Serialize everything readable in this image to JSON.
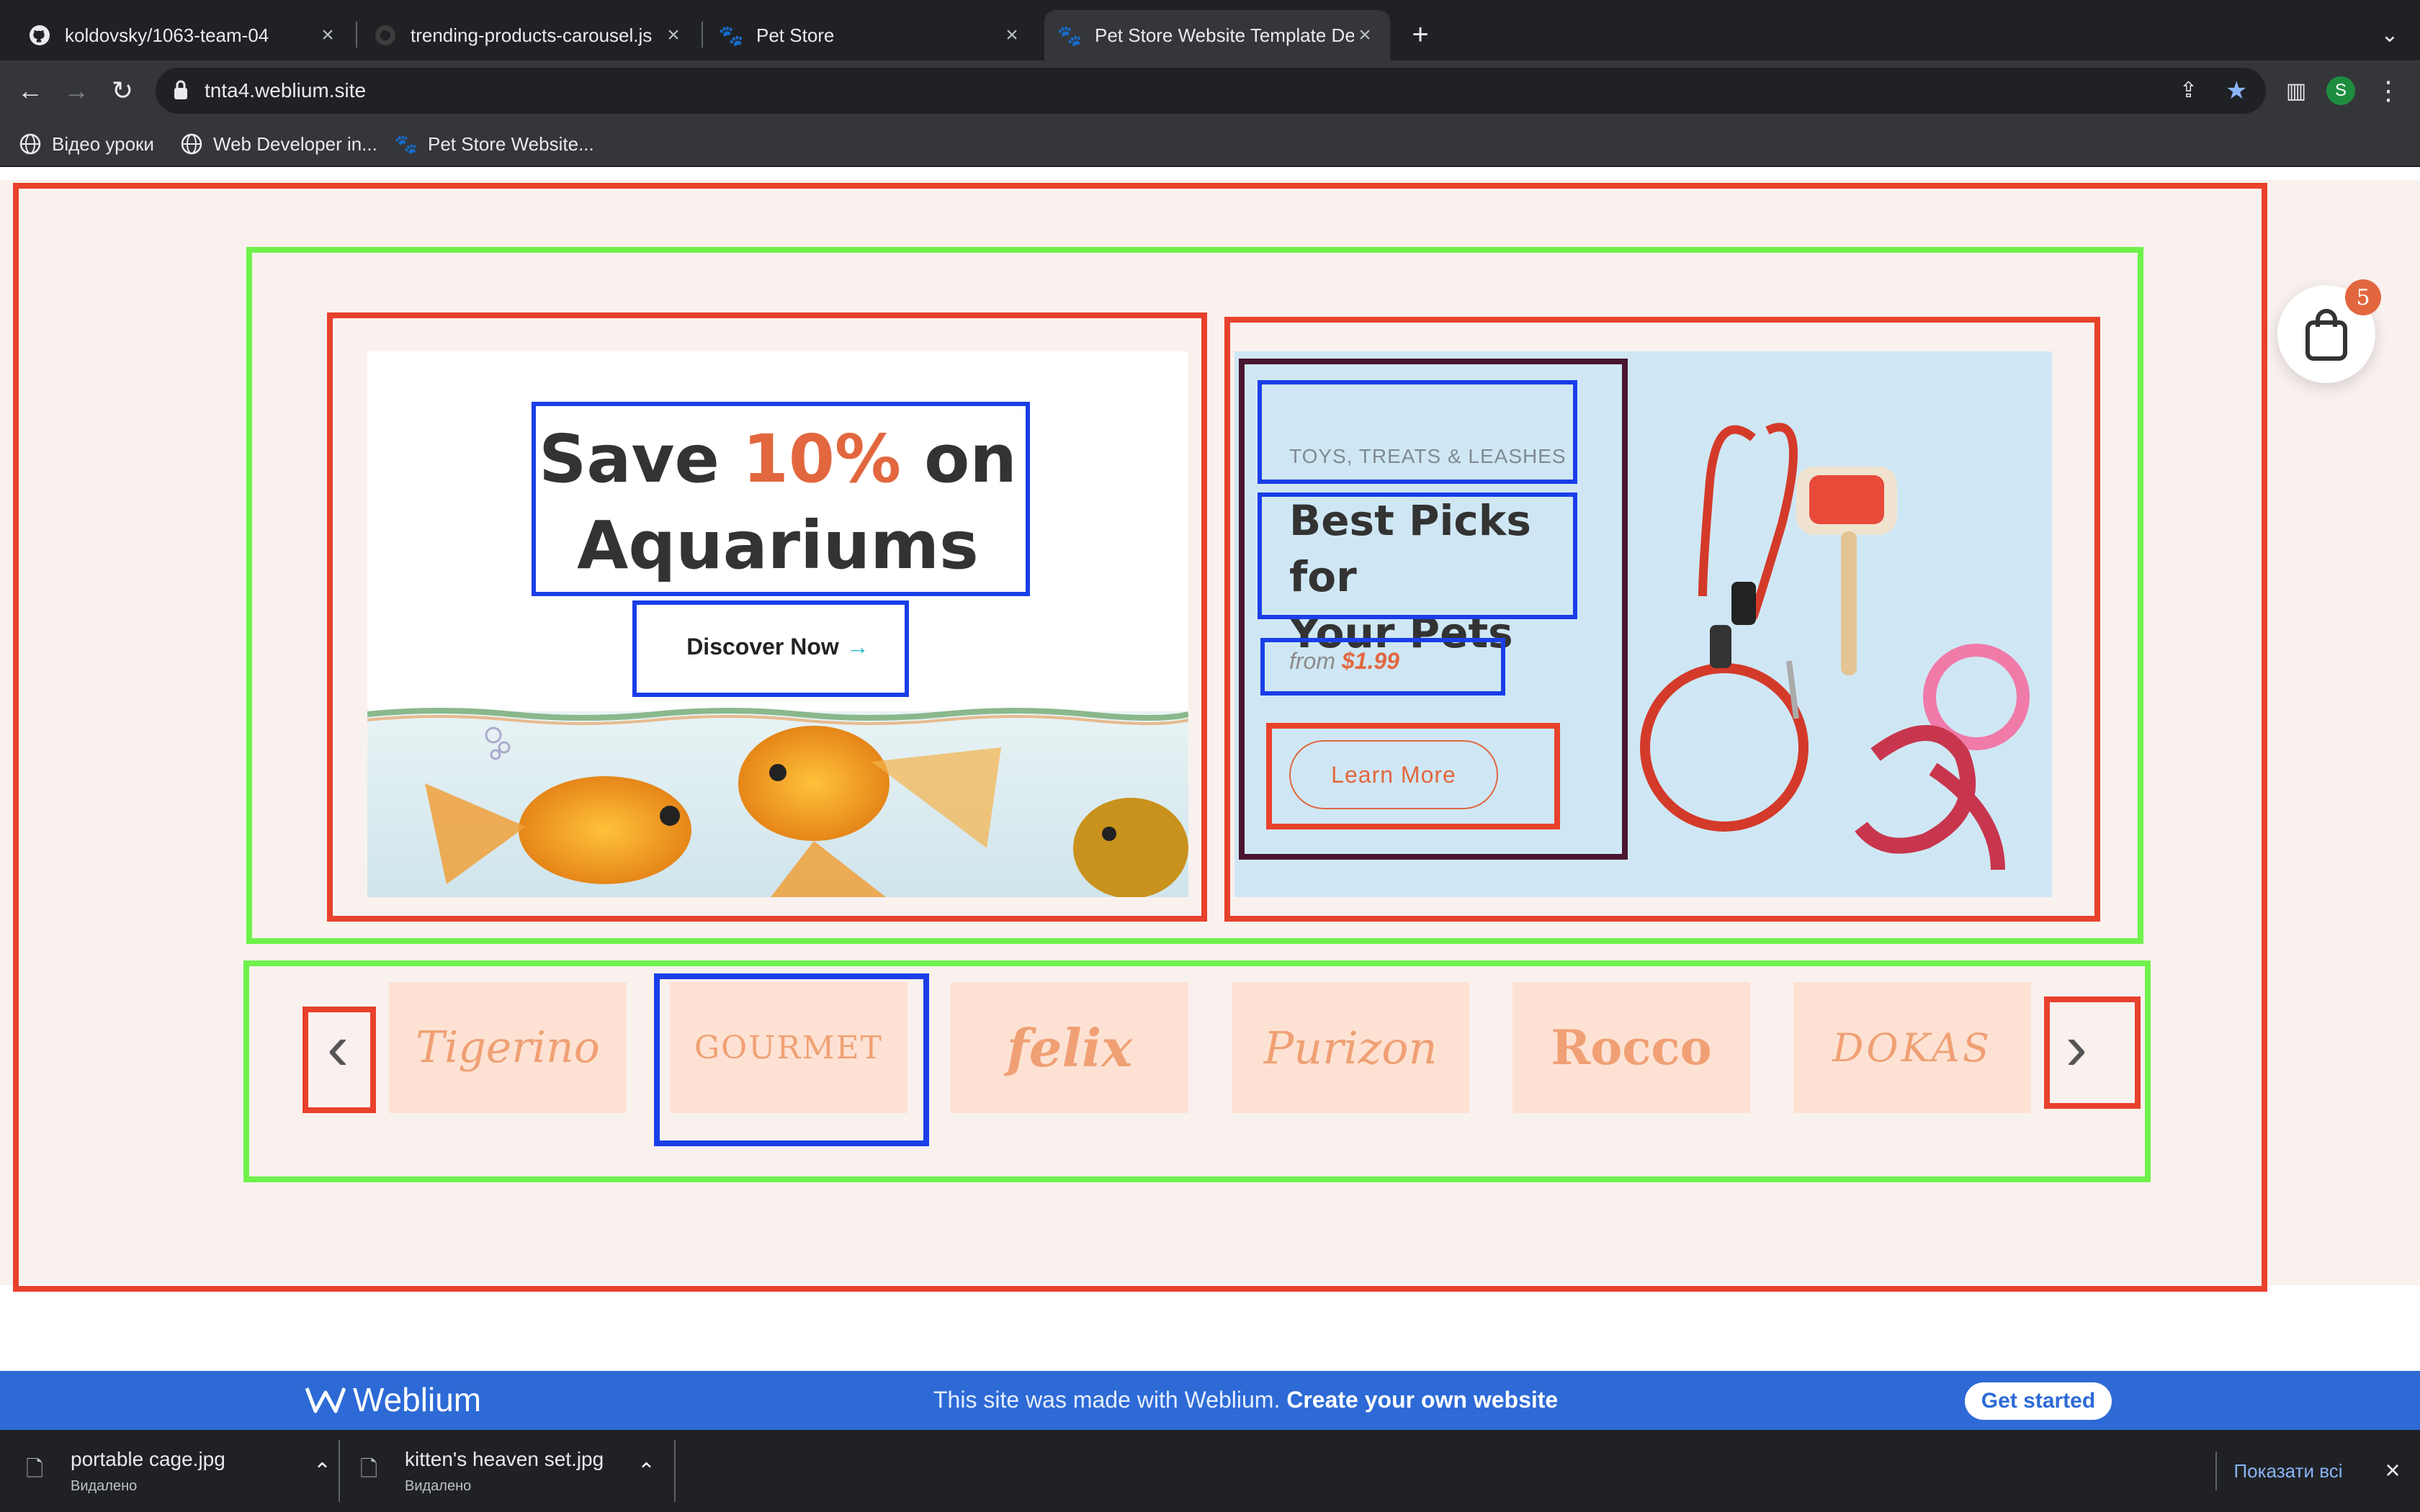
{
  "browser": {
    "tabs": [
      {
        "title": "koldovsky/1063-team-04",
        "icon": "github-icon"
      },
      {
        "title": "trending-products-carousel.js",
        "icon": "github-icon"
      },
      {
        "title": "Pet Store",
        "icon": "paw-icon"
      },
      {
        "title": "Pet Store Website Template De",
        "icon": "paw-icon",
        "active": true
      }
    ],
    "url": "tnta4.weblium.site",
    "profile_initial": "S",
    "bookmarks": [
      {
        "label": "Відео уроки",
        "icon": "globe-icon"
      },
      {
        "label": "Web Developer in...",
        "icon": "globe-icon"
      },
      {
        "label": "Pet Store Website...",
        "icon": "paw-icon"
      }
    ]
  },
  "promo_left": {
    "title_before": "Save ",
    "title_highlight": "10%",
    "title_after": " on",
    "title_line2": "Aquariums",
    "cta": "Discover Now",
    "cta_arrow": "→"
  },
  "promo_right": {
    "eyebrow": "TOYS, TREATS & LEASHES",
    "title_line1": "Best Picks for",
    "title_line2": "Your Pets",
    "price_prefix": "from",
    "price": "$1.99",
    "cta": "Learn More"
  },
  "brands": {
    "prev": "‹",
    "next": "›",
    "items": [
      "Tigerino",
      "GOURMET",
      "felix",
      "Purizon",
      "Rocco",
      "DOKAS"
    ]
  },
  "cart": {
    "count": "5"
  },
  "weblium": {
    "logo": "Weblium",
    "message": "This site was made with Weblium.",
    "message_bold": "Create your own website",
    "button": "Get started"
  },
  "downloads": {
    "items": [
      {
        "name": "portable cage.jpg",
        "status": "Видалено"
      },
      {
        "name": "kitten's heaven set.jpg",
        "status": "Видалено"
      }
    ],
    "show_all": "Показати всі"
  },
  "colors": {
    "accent_orange": "#e2673f",
    "outline_red": "#e8412c",
    "outline_green": "#6ef24a",
    "outline_blue": "#1a3ee8",
    "outline_maroon": "#4a1530",
    "weblium_blue": "#2d6ad6"
  }
}
